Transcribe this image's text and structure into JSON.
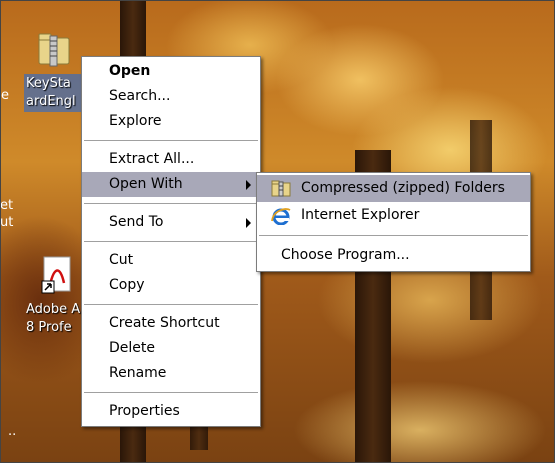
{
  "desktop": {
    "icons": [
      {
        "label_lines": [
          "KeySta",
          "ardEngl"
        ]
      },
      {
        "label_lines": [
          "Adobe A",
          "8 Profe"
        ]
      }
    ],
    "edge_text": [
      "e",
      "et",
      "ut",
      ".."
    ]
  },
  "context_menu": {
    "items": [
      {
        "label": "Open"
      },
      {
        "label": "Search..."
      },
      {
        "label": "Explore"
      },
      {
        "label": "Extract All..."
      },
      {
        "label": "Open With"
      },
      {
        "label": "Send To"
      },
      {
        "label": "Cut"
      },
      {
        "label": "Copy"
      },
      {
        "label": "Create Shortcut"
      },
      {
        "label": "Delete"
      },
      {
        "label": "Rename"
      },
      {
        "label": "Properties"
      }
    ]
  },
  "open_with_submenu": {
    "items": [
      {
        "label": "Compressed (zipped) Folders",
        "icon": "zip-folder-icon"
      },
      {
        "label": "Internet Explorer",
        "icon": "internet-explorer-icon"
      },
      {
        "label": "Choose Program..."
      }
    ]
  },
  "colors": {
    "highlight": "#a8a8b8",
    "selection": "#316ac5"
  }
}
